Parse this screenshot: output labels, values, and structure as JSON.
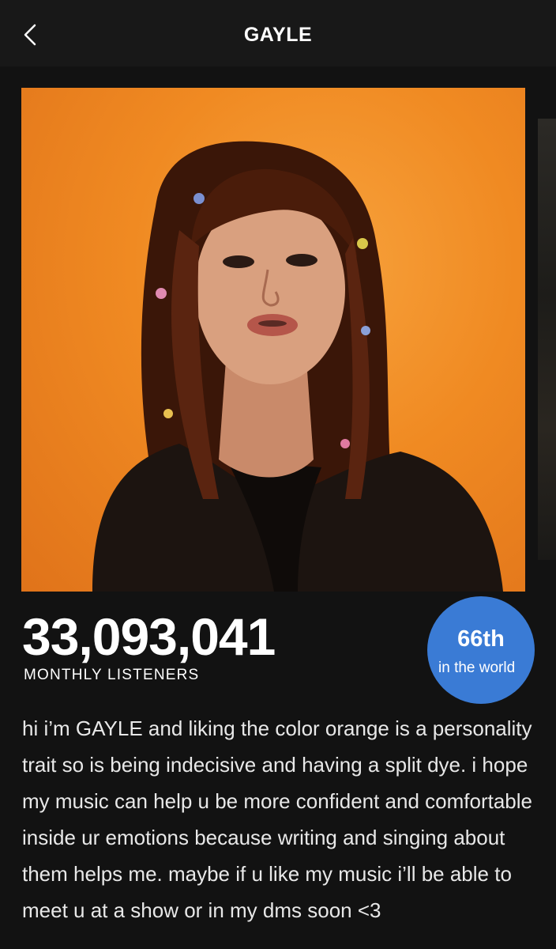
{
  "header": {
    "title": "GAYLE",
    "back_icon": "chevron-left-icon"
  },
  "gallery": {
    "main_photo": "artist-photo",
    "next_photo": "artist-photo-next"
  },
  "stats": {
    "monthly_listeners": "33,093,041",
    "monthly_listeners_label": "MONTHLY LISTENERS"
  },
  "rank": {
    "position": "66th",
    "scope": "in the world"
  },
  "bio": "hi i’m GAYLE and liking the color orange is a personality trait so is being indecisive and having a split dye. i hope my music can help u be more confident and comfortable inside ur emotions because writing and singing about them helps me. maybe if u like my music i’ll be able to meet u at a show or in my dms soon <3",
  "colors": {
    "background": "#121212",
    "header_background": "#181818",
    "rank_badge": "#3a7bd5",
    "photo_background": "#f08a22"
  }
}
